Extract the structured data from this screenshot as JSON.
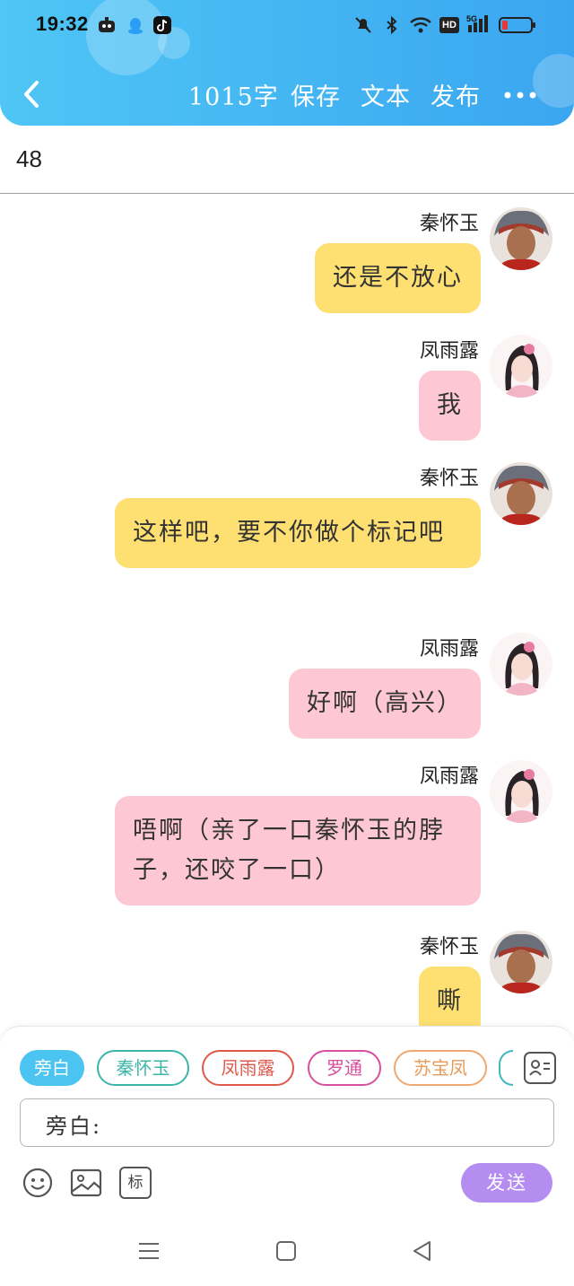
{
  "status_bar": {
    "time": "19:32",
    "left_icons": [
      "app-icon",
      "qq-icon",
      "tiktok-icon"
    ],
    "right_icons": [
      "mute-icon",
      "bluetooth-icon",
      "wifi-icon",
      "hd-icon",
      "signal-5g-icon",
      "battery-icon"
    ],
    "hd_label": "HD",
    "network_label": "5G"
  },
  "toolbar": {
    "word_count": "1015字",
    "save_label": "保存",
    "text_label": "文本",
    "publish_label": "发布"
  },
  "title": "48",
  "messages": [
    {
      "speaker": "秦怀玉",
      "text": "还是不放心",
      "color": "yellow"
    },
    {
      "speaker": "凤雨露",
      "text": "我",
      "color": "pink"
    },
    {
      "speaker": "秦怀玉",
      "text": "这样吧，要不你做个标记吧",
      "color": "yellow"
    },
    {
      "speaker": "凤雨露",
      "text": "好啊（高兴）",
      "color": "pink"
    },
    {
      "speaker": "凤雨露",
      "text": "唔啊（亲了一口秦怀玉的脖子，还咬了一口）",
      "color": "pink"
    },
    {
      "speaker": "秦怀玉",
      "text": "嘶",
      "color": "yellow"
    }
  ],
  "characters": [
    {
      "label": "旁白",
      "color": "#4cc4f2"
    },
    {
      "label": "秦怀玉",
      "color": "#3cb6a8"
    },
    {
      "label": "凤雨露",
      "color": "#e0584a"
    },
    {
      "label": "罗通",
      "color": "#d94fa0"
    },
    {
      "label": "苏宝凤",
      "color": "#f0a870"
    }
  ],
  "input": {
    "label": "旁白:"
  },
  "tools": {
    "mark_label": "标"
  },
  "send_label": "发送",
  "colors": {
    "header": "#3aa6f0",
    "bubble_yellow": "#fddf72",
    "bubble_pink": "#fdc8d3",
    "send": "#b58cf0"
  }
}
